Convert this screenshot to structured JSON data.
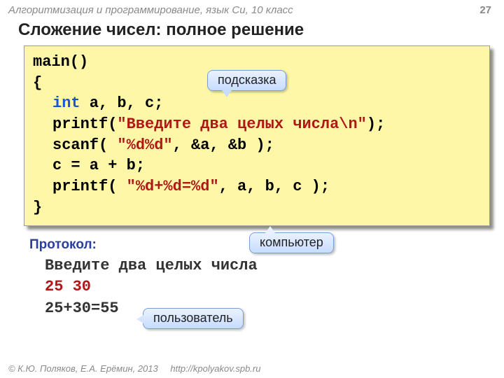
{
  "header": {
    "course": "Алгоритмизация и программирование, язык Си, 10 класс",
    "page": "27"
  },
  "title": "Сложение чисел: полное решение",
  "code": {
    "l1": "main()",
    "l2": "{",
    "kw_int": "int",
    "decl_rest": " a, b, c;",
    "pr1_a": "printf(",
    "pr1_str": "\"Введите два целых числа\\n\"",
    "pr1_b": ");",
    "sc_a": "scanf( ",
    "sc_str": "\"%d%d\"",
    "sc_b": ", &a, &b );",
    "assign": "c = a + b;",
    "pr2_a": "printf( ",
    "pr2_str": "\"%d+%d=%d\"",
    "pr2_b": ", a, b, c );",
    "l_end": "}"
  },
  "protocol": {
    "label": "Протокол:",
    "line1": "Введите два целых числа",
    "line2": "25 30",
    "line3": "25+30=55"
  },
  "callouts": {
    "hint": "подсказка",
    "computer": "компьютер",
    "user": "пользователь"
  },
  "footer": {
    "copyright": "© К.Ю. Поляков, Е.А. Ерёмин, 2013",
    "url": "http://kpolyakov.spb.ru"
  }
}
